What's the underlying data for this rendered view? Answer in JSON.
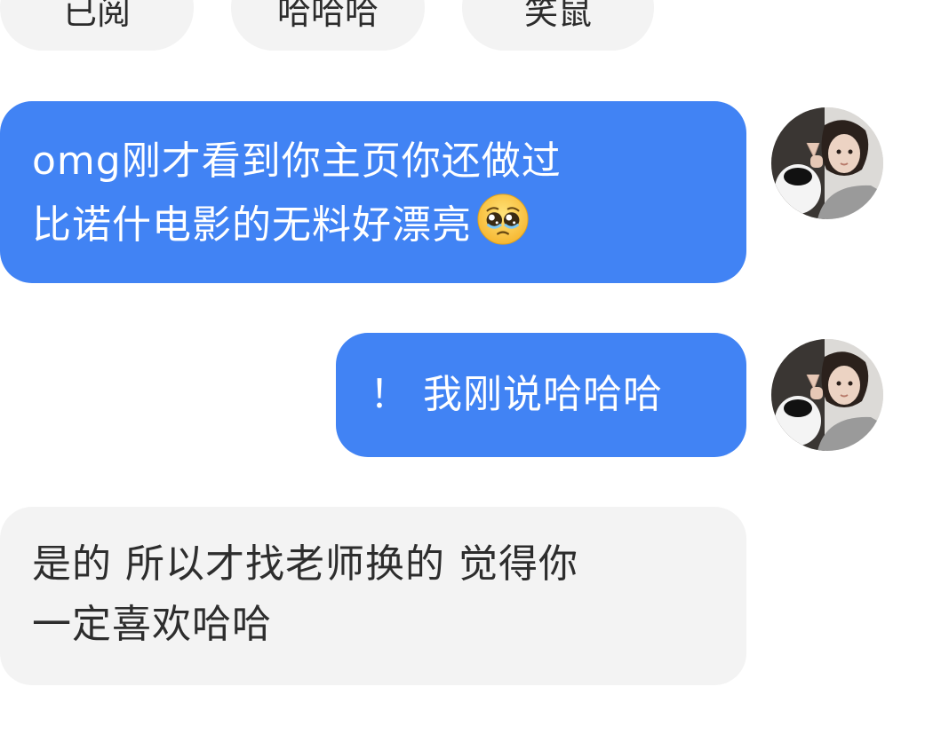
{
  "quick_replies": [
    {
      "label": "已阅"
    },
    {
      "label": "哈哈哈"
    },
    {
      "label": "笑鼠"
    }
  ],
  "messages": [
    {
      "direction": "outgoing",
      "lines": [
        "omg刚才看到你主页你还做过",
        "比诺什电影的无料好漂亮"
      ],
      "emoji": "pleading-face-emoji"
    },
    {
      "direction": "outgoing",
      "lines": [
        "！ 我刚说哈哈哈"
      ]
    },
    {
      "direction": "incoming",
      "lines": [
        "是的 所以才找老师换的 觉得你",
        "一定喜欢哈哈"
      ]
    }
  ],
  "colors": {
    "outgoing_bubble": "#4183f4",
    "incoming_bubble": "#f3f3f3",
    "chip_bg": "#f3f3f3",
    "background": "#ffffff"
  }
}
